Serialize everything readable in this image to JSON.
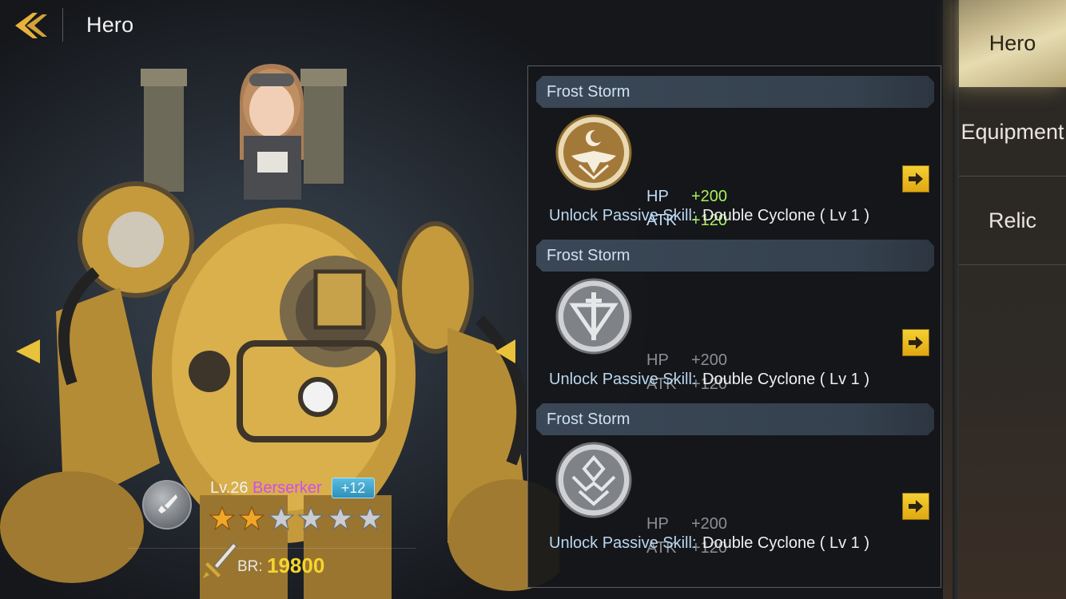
{
  "header": {
    "title": "Hero"
  },
  "tabs": [
    {
      "label": "Hero",
      "active": true
    },
    {
      "label": "Equipment",
      "active": false
    },
    {
      "label": "Relic",
      "active": false
    }
  ],
  "panel": {
    "sections": [
      {
        "title": "Frost Storm",
        "emblem": "phoenix-moon-emblem-icon",
        "state": "active",
        "stats": [
          {
            "name": "HP",
            "value": "+200"
          },
          {
            "name": "ATK",
            "value": "+120"
          }
        ],
        "skill_label": "Unlock Passive Skill:",
        "skill_value": "Double Cyclone ( Lv 1 )"
      },
      {
        "title": "Frost Storm",
        "emblem": "sword-shield-emblem-icon",
        "state": "locked",
        "stats": [
          {
            "name": "HP",
            "value": "+200"
          },
          {
            "name": "ATK",
            "value": "+120"
          }
        ],
        "skill_label": "Unlock Passive Skill:",
        "skill_value": "Double Cyclone ( Lv 1 )"
      },
      {
        "title": "Frost Storm",
        "emblem": "crown-emblem-icon",
        "state": "locked",
        "stats": [
          {
            "name": "HP",
            "value": "+200"
          },
          {
            "name": "ATK",
            "value": "+120"
          }
        ],
        "skill_label": "Unlock Passive Skill:",
        "skill_value": "Double Cyclone ( Lv 1 )"
      }
    ]
  },
  "hero": {
    "level": "Lv.26",
    "class": "Berserker",
    "enhance": "+12",
    "stars_filled": 2,
    "stars_total": 6,
    "br_label": "BR:",
    "br_value": "19800"
  },
  "colors": {
    "accent_gold": "#f6d52c",
    "class_purple": "#d24cf0",
    "stat_green": "#a6f05c",
    "stat_label_blue": "#bfdcf5"
  }
}
